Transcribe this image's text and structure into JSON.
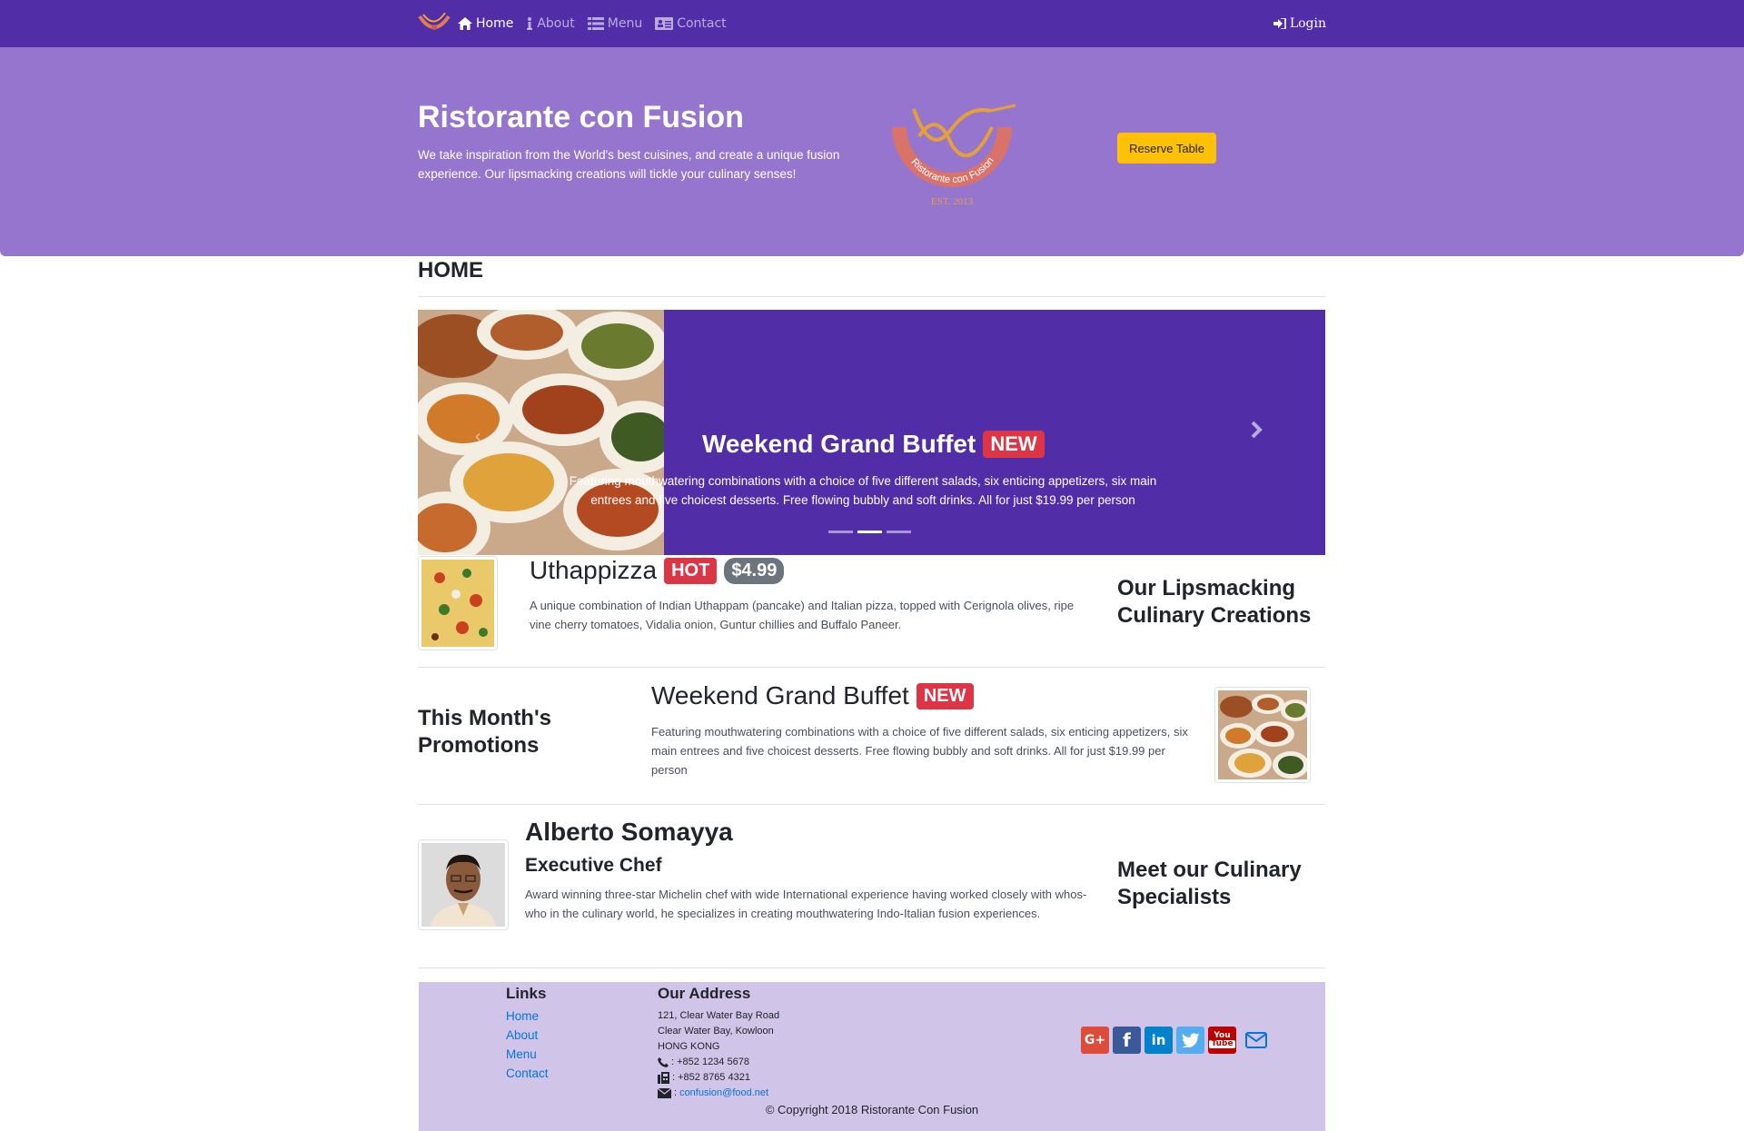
{
  "navbar": {
    "items": [
      {
        "label": "Home",
        "icon": "home-icon",
        "active": true
      },
      {
        "label": "About",
        "icon": "info-icon",
        "active": false
      },
      {
        "label": "Menu",
        "icon": "list-icon",
        "active": false
      },
      {
        "label": "Contact",
        "icon": "address-card-icon",
        "active": false
      }
    ],
    "login": "Login"
  },
  "jumbotron": {
    "title": "Ristorante con Fusion",
    "text": "We take inspiration from the World's best cuisines, and create a unique fusion experience. Our lipsmacking creations will tickle your culinary senses!",
    "logo_text": "Ristorante con Fusion",
    "logo_est": "EST. 2013",
    "reserve_button": "Reserve Table"
  },
  "page": {
    "heading": "HOME"
  },
  "carousel": {
    "title": "Weekend Grand Buffet",
    "badge": "NEW",
    "text": "Featuring mouthwatering combinations with a choice of five different salads, six enticing appetizers, six main entrees and five choicest desserts. Free flowing bubbly and soft drinks. All for just $19.99 per person",
    "active_index": 1
  },
  "dish": {
    "title": "Uthappizza",
    "badge": "HOT",
    "price": "$4.99",
    "text": "A unique combination of Indian Uthappam (pancake) and Italian pizza, topped with Cerignola olives, ripe vine cherry tomatoes, Vidalia onion, Guntur chillies and Buffalo Paneer.",
    "side_heading": "Our Lipsmacking Culinary Creations"
  },
  "promotion": {
    "side_heading": "This Month's Promotions",
    "title": "Weekend Grand Buffet",
    "badge": "NEW",
    "text": "Featuring mouthwatering combinations with a choice of five different salads, six enticing appetizers, six main entrees and five choicest desserts. Free flowing bubbly and soft drinks. All for just $19.99 per person"
  },
  "leader": {
    "name": "Alberto Somayya",
    "designation": "Executive Chef",
    "text": "Award winning three-star Michelin chef with wide International experience having worked closely with whos-who in the culinary world, he specializes in creating mouthwatering Indo-Italian fusion experiences.",
    "side_heading": "Meet our Culinary Specialists"
  },
  "footer": {
    "links_heading": "Links",
    "links": [
      "Home",
      "About",
      "Menu",
      "Contact"
    ],
    "address_heading": "Our Address",
    "address_lines": [
      "121, Clear Water Bay Road",
      "Clear Water Bay, Kowloon",
      "HONG KONG"
    ],
    "phone": ": +852 1234 5678",
    "fax": ": +852 8765 4321",
    "email_prefix": ":",
    "email": "confusion@food.net",
    "social": [
      "google-plus-icon",
      "facebook-icon",
      "linkedin-icon",
      "twitter-icon",
      "youtube-icon",
      "envelope-icon"
    ],
    "copyright": "© Copyright 2018 Ristorante Con Fusion"
  },
  "colors": {
    "navbar": "#512da8",
    "jumbotron": "#9575cd",
    "footer": "#d1c4e9",
    "warning": "#ffc107",
    "danger": "#dc3545",
    "secondary": "#6c757d",
    "link": "#0275d8"
  }
}
